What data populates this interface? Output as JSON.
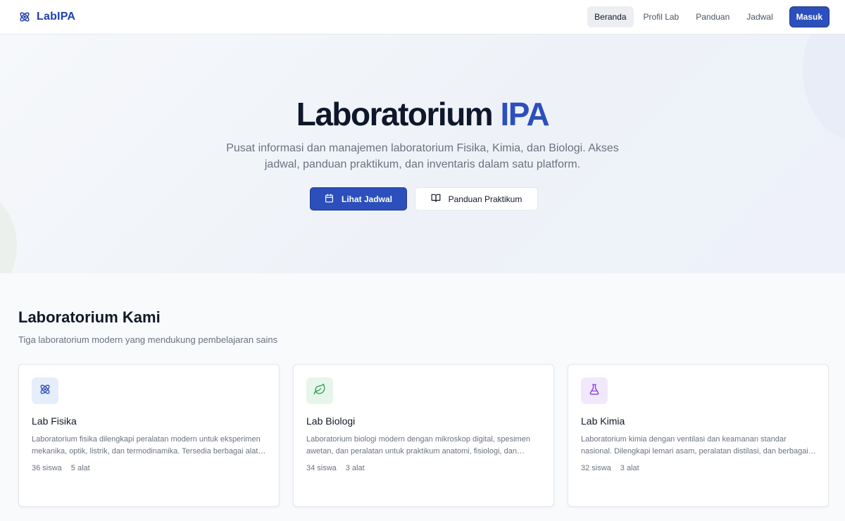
{
  "navbar": {
    "brand": "LabIPA",
    "items": [
      {
        "label": "Beranda"
      },
      {
        "label": "Profil Lab"
      },
      {
        "label": "Panduan"
      },
      {
        "label": "Jadwal"
      }
    ],
    "login_label": "Masuk"
  },
  "hero": {
    "title_main": "Laboratorium",
    "title_accent": "IPA",
    "subtitle": "Pusat informasi dan manajemen laboratorium Fisika, Kimia, dan Biologi. Akses jadwal, panduan praktikum, dan inventaris dalam satu platform.",
    "primary_button": "Lihat Jadwal",
    "secondary_button": "Panduan Praktikum"
  },
  "labs_section": {
    "title": "Laboratorium Kami",
    "subtitle": "Tiga laboratorium modern yang mendukung pembelajaran sains",
    "cards": [
      {
        "icon": "atom-icon",
        "title": "Lab Fisika",
        "description": "Laboratorium fisika dilengkapi peralatan modern untuk eksperimen mekanika, optik, listrik, dan termodinamika. Tersedia berbagai alat ukur presisi.",
        "students": "36 siswa",
        "tools": "5 alat"
      },
      {
        "icon": "leaf-icon",
        "title": "Lab Biologi",
        "description": "Laboratorium biologi modern dengan mikroskop digital, spesimen awetan, dan peralatan untuk praktikum anatomi, fisiologi, dan mikrobiologi.",
        "students": "34 siswa",
        "tools": "3 alat"
      },
      {
        "icon": "flask-icon",
        "title": "Lab Kimia",
        "description": "Laboratorium kimia dengan ventilasi dan keamanan standar nasional. Dilengkapi lemari asam, peralatan distilasi, dan berbagai bahan kimia.",
        "students": "32 siswa",
        "tools": "3 alat"
      }
    ]
  },
  "colors": {
    "brand": "#2c4fbb",
    "physics_bg": "#e6edfb",
    "biology_bg": "#e6f6ea",
    "chemistry_bg": "#f1e9fb"
  }
}
